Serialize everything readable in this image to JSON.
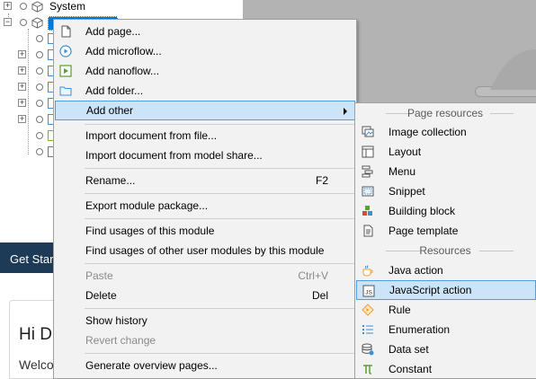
{
  "tree": {
    "system_label": "System"
  },
  "context_menu": {
    "items": [
      {
        "label": "Add page...",
        "icon": "page-icon"
      },
      {
        "label": "Add microflow...",
        "icon": "microflow-icon"
      },
      {
        "label": "Add nanoflow...",
        "icon": "nanoflow-icon"
      },
      {
        "label": "Add folder...",
        "icon": "folder-icon"
      },
      {
        "label": "Add other",
        "icon": "",
        "submenu": true,
        "highlighted": true
      },
      {
        "label": "Import document from file..."
      },
      {
        "label": "Import document from model share..."
      },
      {
        "label": "Rename...",
        "shortcut": "F2"
      },
      {
        "label": "Export module package..."
      },
      {
        "label": "Find usages of this module"
      },
      {
        "label": "Find usages of other user modules by this module"
      },
      {
        "label": "Paste",
        "shortcut": "Ctrl+V",
        "disabled": true
      },
      {
        "label": "Delete",
        "shortcut": "Del"
      },
      {
        "label": "Show history"
      },
      {
        "label": "Revert change",
        "disabled": true
      },
      {
        "label": "Generate overview pages..."
      }
    ]
  },
  "submenu": {
    "page_resources_header": "Page resources",
    "resources_header": "Resources",
    "page_resources": [
      {
        "label": "Image collection",
        "icon": "image-collection-icon"
      },
      {
        "label": "Layout",
        "icon": "layout-icon"
      },
      {
        "label": "Menu",
        "icon": "menu-icon"
      },
      {
        "label": "Snippet",
        "icon": "snippet-icon"
      },
      {
        "label": "Building block",
        "icon": "building-block-icon"
      },
      {
        "label": "Page template",
        "icon": "page-template-icon"
      }
    ],
    "resources": [
      {
        "label": "Java action",
        "icon": "java-action-icon"
      },
      {
        "label": "JavaScript action",
        "icon": "javascript-action-icon",
        "highlighted": true
      },
      {
        "label": "Rule",
        "icon": "rule-icon"
      },
      {
        "label": "Enumeration",
        "icon": "enumeration-icon"
      },
      {
        "label": "Data set",
        "icon": "data-set-icon"
      },
      {
        "label": "Constant",
        "icon": "constant-icon"
      }
    ]
  },
  "preview": {
    "get_started": "Get Started",
    "hi_title": "Hi D",
    "hi_text": "Welco"
  },
  "colors": {
    "highlight_bg": "#cce4f7",
    "highlight_border": "#4d9de0",
    "menu_bg": "#f2f2f2",
    "header_dark": "#1d3b56"
  }
}
